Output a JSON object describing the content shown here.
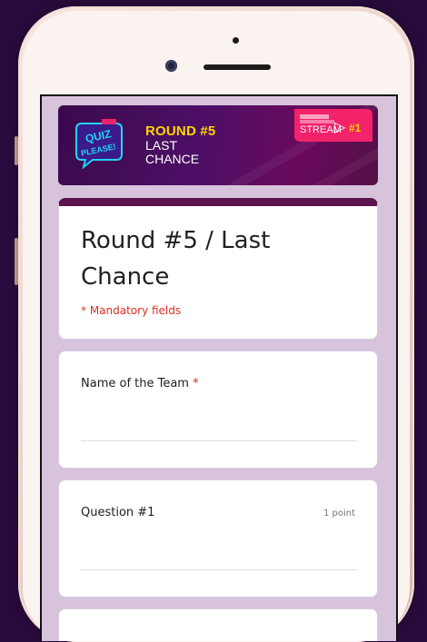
{
  "banner": {
    "logo_text": "QUIZ PLEASE!",
    "round_label": "ROUND #5",
    "subtitle": "LAST CHANCE",
    "stream_label": "STREAM",
    "stream_number": "#1"
  },
  "form": {
    "title": "Round #5 / Last Chance",
    "mandatory_note": "* Mandatory fields"
  },
  "questions": [
    {
      "label": "Name of the Team",
      "required_mark": "*",
      "points": ""
    },
    {
      "label": "Question #1",
      "required_mark": "",
      "points": "1 point"
    }
  ],
  "colors": {
    "background": "#2a0b3d",
    "form_background": "#d7c3dc",
    "accent": "#5c1350",
    "banner": "#4d0f66",
    "stream": "#f2226b",
    "required": "#d93025"
  }
}
